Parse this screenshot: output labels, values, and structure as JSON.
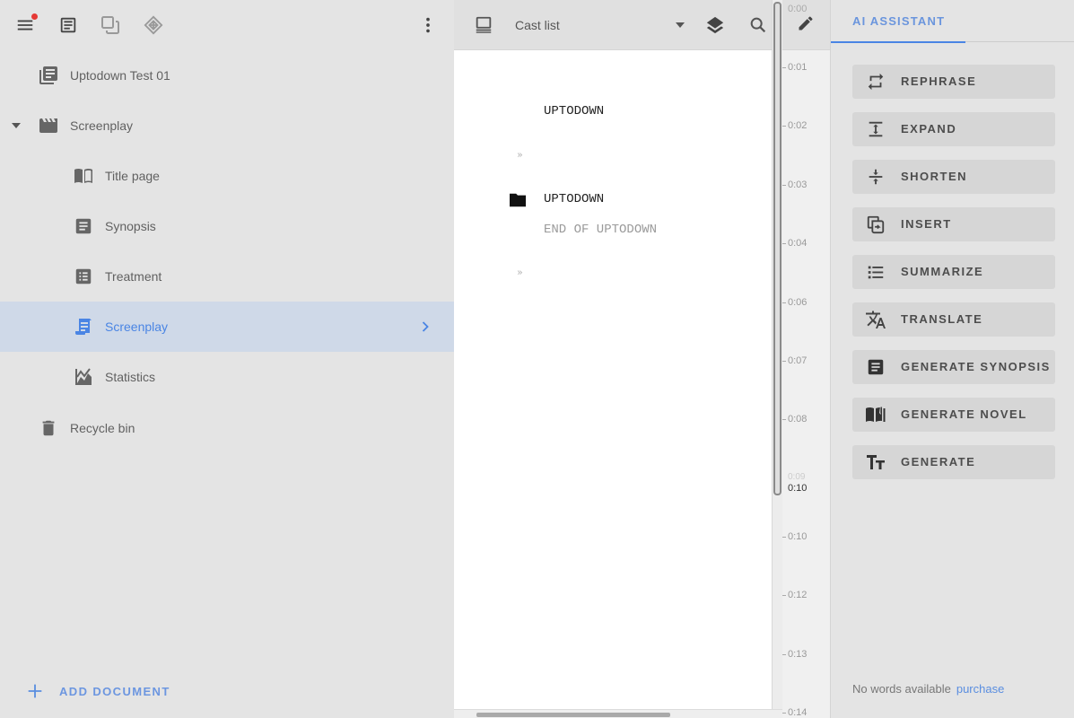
{
  "sidebar": {
    "toolbar": {
      "menu_icon": "menu-icon",
      "document_icon": "document-icon",
      "copy_icon": "copy-icon",
      "diamond_icon": "diamond-icon",
      "more_icon": "more-vert-icon",
      "notification_color": "#e53935"
    },
    "project": {
      "label": "Uptodown Test 01",
      "icon": "library-books-icon"
    },
    "screenplay_folder": {
      "label": "Screenplay",
      "icon": "clapperboard-icon",
      "expanded": true
    },
    "items": [
      {
        "label": "Title page",
        "icon": "open-book-icon"
      },
      {
        "label": "Synopsis",
        "icon": "article-icon"
      },
      {
        "label": "Treatment",
        "icon": "list-table-icon"
      },
      {
        "label": "Screenplay",
        "icon": "script-icon",
        "selected": true
      },
      {
        "label": "Statistics",
        "icon": "chart-icon"
      }
    ],
    "recycle_bin": {
      "label": "Recycle bin",
      "icon": "trash-icon"
    },
    "add_document": "ADD DOCUMENT"
  },
  "editor": {
    "toolbar": {
      "cast_list": "Cast list",
      "layers_icon": "layers-icon",
      "search_icon": "search-icon",
      "edit_icon": "pencil-icon",
      "view_icon": "laptop-icon"
    },
    "script": [
      {
        "type": "heading",
        "text": "UPTODOWN"
      },
      {
        "type": "marker",
        "text": "»"
      },
      {
        "type": "folder",
        "text": "UPTODOWN"
      },
      {
        "type": "folder-end",
        "text": "END OF UPTODOWN"
      },
      {
        "type": "marker",
        "text": "»"
      }
    ],
    "timeline": {
      "header": "0:00",
      "ticks": [
        "0:01",
        "0:02",
        "0:03",
        "0:04",
        "0:06",
        "0:07",
        "0:08",
        "0:09",
        "0:10",
        "0:10",
        "0:12",
        "0:13",
        "0:14"
      ],
      "current": "0:10"
    }
  },
  "ai_panel": {
    "tab": "AI ASSISTANT",
    "buttons": [
      {
        "label": "REPHRASE",
        "icon": "repeat-icon"
      },
      {
        "label": "EXPAND",
        "icon": "expand-vertical-icon"
      },
      {
        "label": "SHORTEN",
        "icon": "compress-vertical-icon"
      },
      {
        "label": "INSERT",
        "icon": "insert-icon"
      },
      {
        "label": "SUMMARIZE",
        "icon": "list-bullets-icon"
      },
      {
        "label": "TRANSLATE",
        "icon": "translate-icon"
      },
      {
        "label": "GENERATE SYNOPSIS",
        "icon": "article-icon"
      },
      {
        "label": "GENERATE NOVEL",
        "icon": "book-edit-icon"
      },
      {
        "label": "GENERATE",
        "icon": "text-size-icon"
      }
    ],
    "words_status": "No words available",
    "purchase_link": "purchase"
  },
  "colors": {
    "accent": "#4a85e4",
    "selected_bg": "#cfd9e8",
    "panel_bg": "#e4e4e4"
  }
}
